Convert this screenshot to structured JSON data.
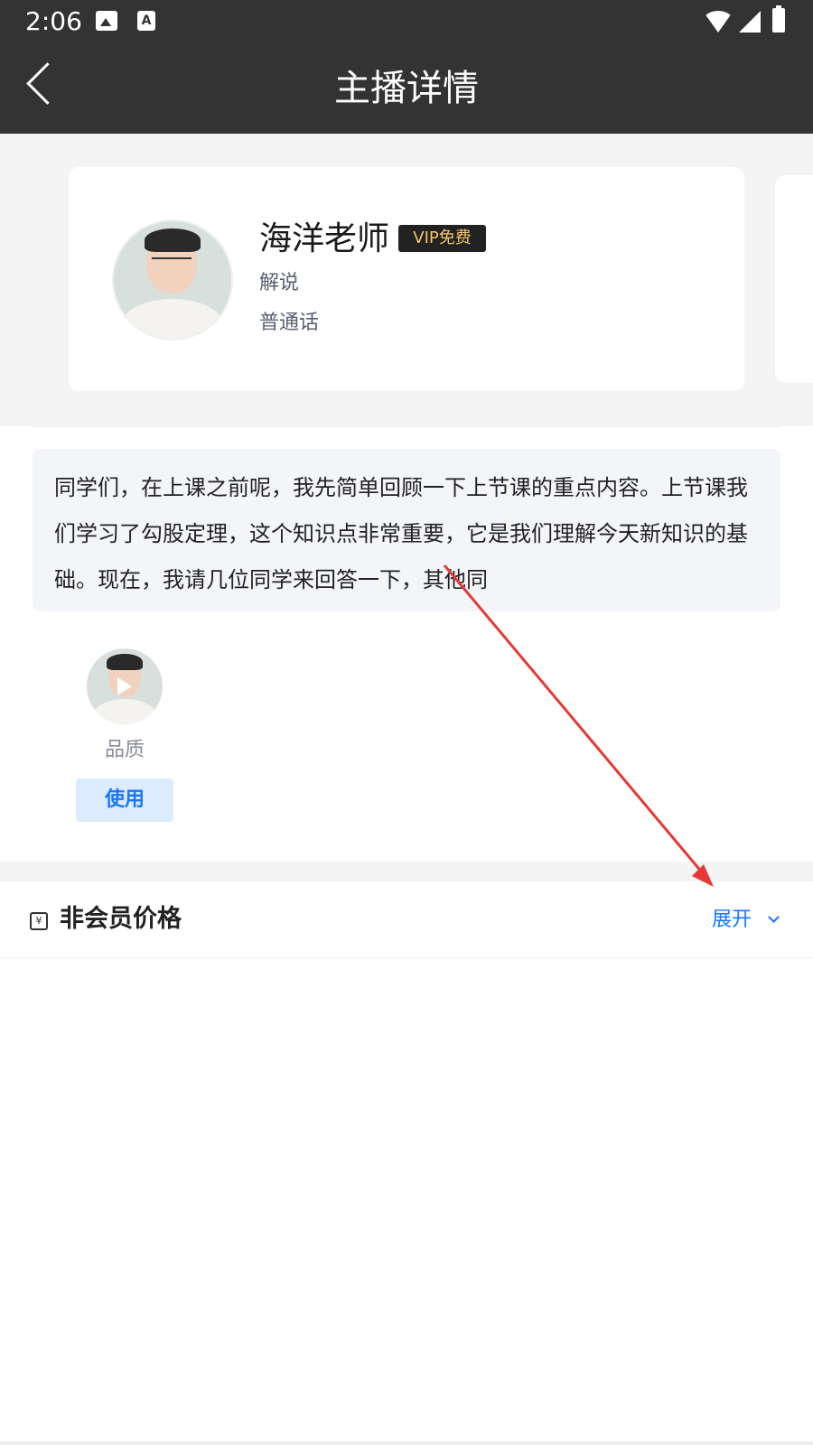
{
  "status_bar": {
    "time": "2:06",
    "icons": [
      "image-icon",
      "text-icon",
      "wifi-icon",
      "signal-icon",
      "battery-icon"
    ],
    "a_glyph": "A"
  },
  "app_bar": {
    "title": "主播详情",
    "back_icon": "chevron-left-icon"
  },
  "host": {
    "name": "海洋老师",
    "badge": "VIP免费",
    "role": "解说",
    "language": "普通话"
  },
  "script": {
    "text": "同学们，在上课之前呢，我先简单回顾一下上节课的重点内容。上节课我们学习了勾股定理，这个知识点非常重要，它是我们理解今天新知识的基础。现在，我请几位同学来回答一下，其他同"
  },
  "voice": {
    "label": "品质",
    "use_button": "使用"
  },
  "price": {
    "icon": "yen-icon",
    "icon_glyph": "¥",
    "title": "非会员价格",
    "expand": "展开"
  },
  "colors": {
    "header_bg": "#333333",
    "accent": "#1677ff",
    "vip_gold": "#f4c46a",
    "annotation_red": "#e53935"
  }
}
